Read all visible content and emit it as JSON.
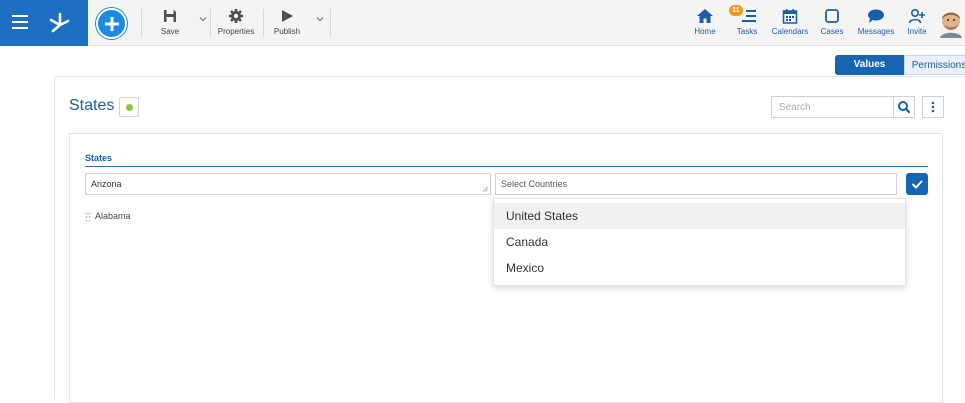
{
  "toolbar": {
    "save_label": "Save",
    "properties_label": "Properties",
    "publish_label": "Publish",
    "icons": {
      "menu": "hamburger-menu-icon",
      "logo": "app-logo-icon",
      "add": "plus-icon",
      "save": "floppy-disk-icon",
      "properties": "gear-icon",
      "publish": "play-icon"
    }
  },
  "nav": {
    "home": "Home",
    "tasks": "Tasks",
    "tasks_badge": "11",
    "calendars": "Calendars",
    "cases": "Cases",
    "messages": "Messages",
    "invite": "Invite"
  },
  "tabs": [
    {
      "label": "Values",
      "active": true
    },
    {
      "label": "Permissions",
      "active": false
    }
  ],
  "page": {
    "title": "States",
    "status_color": "#8cc63f"
  },
  "search": {
    "placeholder": "Search"
  },
  "form": {
    "section_title": "States",
    "name_value": "Arizona",
    "country_placeholder": "Select Countries",
    "rows": [
      "Alabama"
    ]
  },
  "dropdown": {
    "options": [
      "United States",
      "Canada",
      "Mexico"
    ],
    "highlighted_index": 0
  },
  "colors": {
    "brand": "#1c6fc2",
    "accent": "#1565b3",
    "badge": "#f19a1b"
  }
}
